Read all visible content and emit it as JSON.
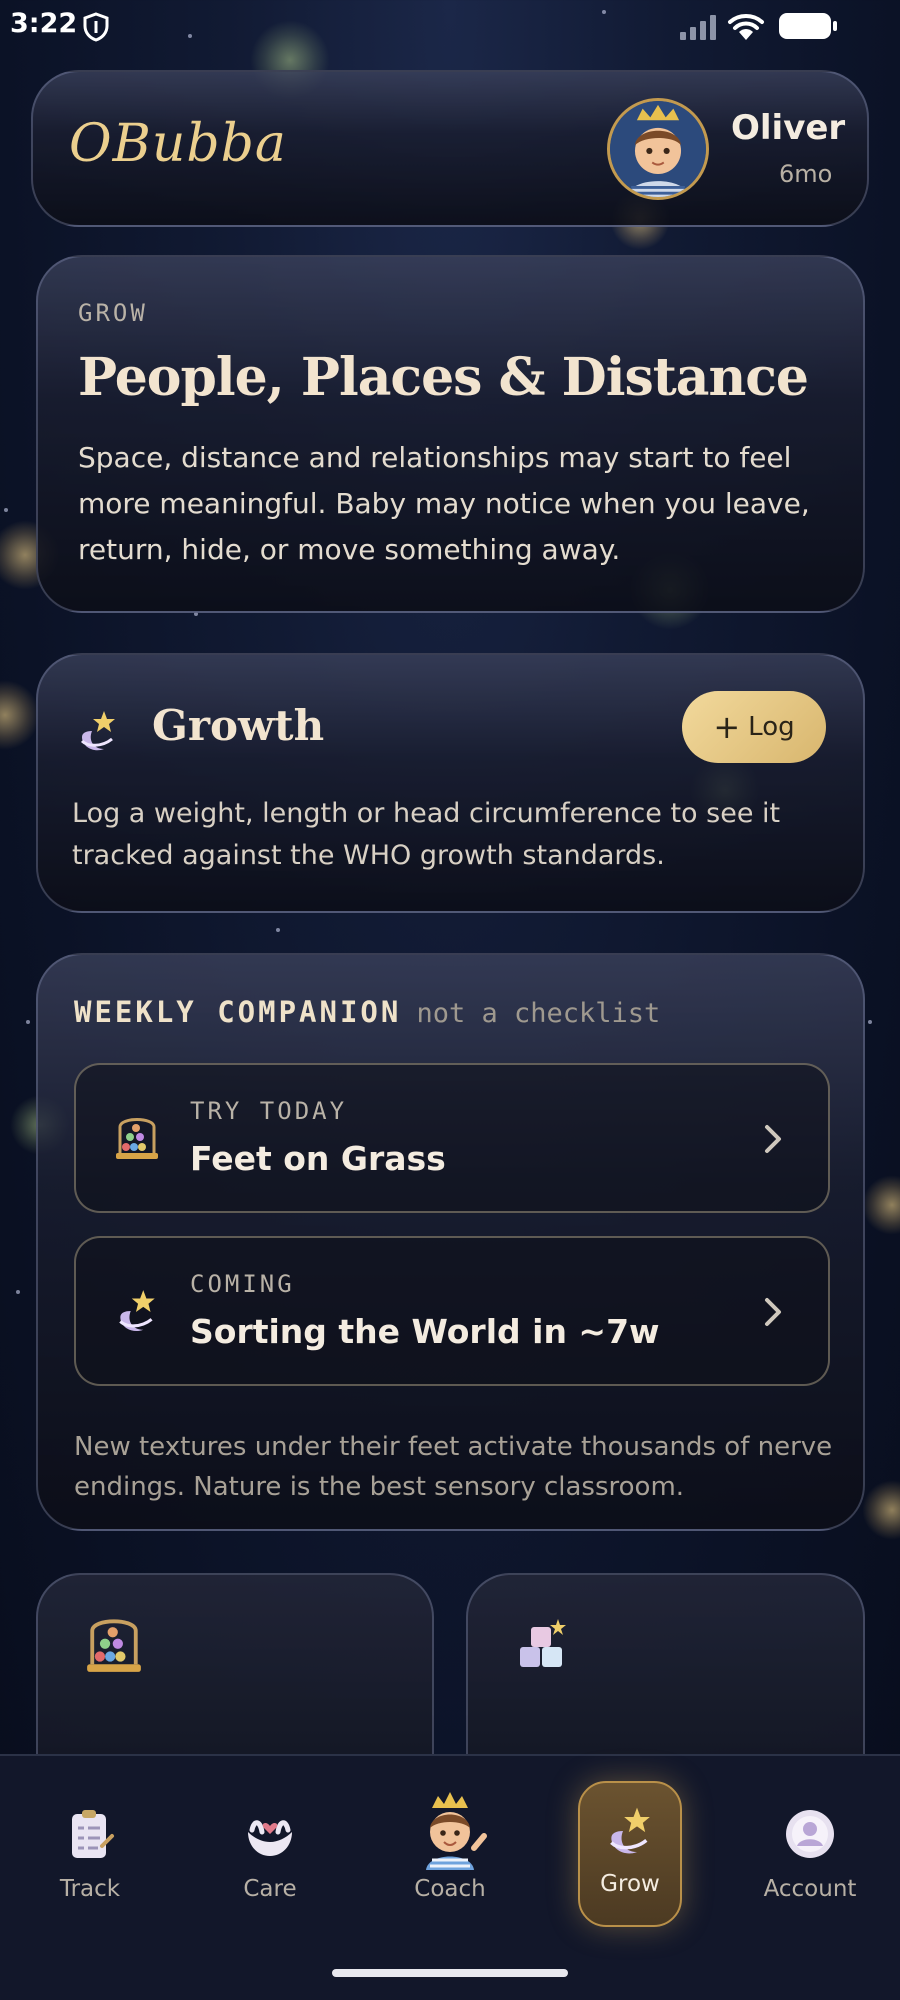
{
  "status_bar": {
    "time": "3:22",
    "icons": [
      "shield-icon",
      "signal-icon",
      "wifi-icon",
      "battery-icon"
    ]
  },
  "header": {
    "logo": "OBubba",
    "child": {
      "name": "Oliver",
      "age": "6mo",
      "avatar": "baby-avatar-icon"
    }
  },
  "hero": {
    "eyebrow": "GROW",
    "title": "People, Places & Distance",
    "body": "Space, distance and relationships may start to feel more meaningful. Baby may notice when you leave, return, hide, or move something away."
  },
  "growth": {
    "icon": "moon-star-icon",
    "title": "Growth",
    "button_plus": "+",
    "button_label": "Log",
    "body": "Log a weight, length or head circumference to see it tracked against the WHO growth standards."
  },
  "weekly": {
    "title": "WEEKLY COMPANION",
    "subtitle": "not a checklist",
    "activities": [
      {
        "kicker": "TRY TODAY",
        "title": "Feet on Grass",
        "icon": "abacus-icon"
      },
      {
        "kicker": "COMING",
        "title": "Sorting the World in ~7w",
        "icon": "moon-star-icon"
      }
    ],
    "tip": "New textures under their feet activate thousands of nerve endings. Nature is the best sensory classroom."
  },
  "tiles": [
    {
      "icon": "abacus-icon"
    },
    {
      "icon": "blocks-icon"
    }
  ],
  "nav": {
    "items": [
      {
        "label": "Track",
        "icon": "clipboard-icon",
        "active": false
      },
      {
        "label": "Care",
        "icon": "heart-hands-icon",
        "active": false
      },
      {
        "label": "Coach",
        "icon": "baby-coach-icon",
        "active": false
      },
      {
        "label": "Grow",
        "icon": "moon-star-icon",
        "active": true
      },
      {
        "label": "Account",
        "icon": "account-icon",
        "active": false
      }
    ]
  },
  "colors": {
    "background": "#0b1226",
    "accent_gold": "#d8b66e",
    "text_cream": "#f2e4cf",
    "active_tab": "#6b5330"
  }
}
